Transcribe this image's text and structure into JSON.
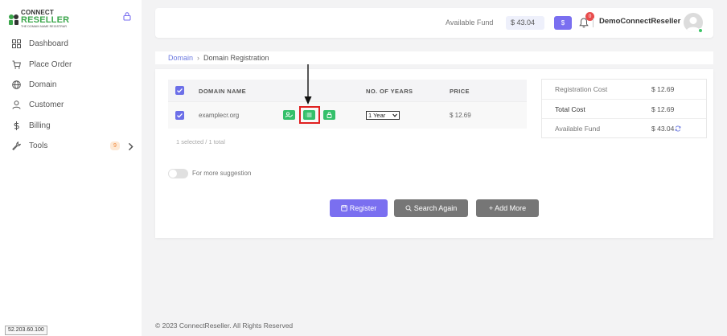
{
  "brand": {
    "line1": "CONNECT",
    "line2": "RESELLER",
    "tagline": "THE DOMAIN NAME REGISTRAR"
  },
  "sidebar": {
    "items": [
      {
        "label": "Dashboard",
        "icon": "grid-icon"
      },
      {
        "label": "Place Order",
        "icon": "cart-icon"
      },
      {
        "label": "Domain",
        "icon": "globe-icon"
      },
      {
        "label": "Customer",
        "icon": "user-icon"
      },
      {
        "label": "Billing",
        "icon": "dollar-icon"
      },
      {
        "label": "Tools",
        "icon": "wrench-icon",
        "badge": "9"
      }
    ]
  },
  "header": {
    "fund_label": "Available Fund",
    "fund_value": "$ 43.04",
    "add_fund_label": "$",
    "notifications_count": "0",
    "username": "DemoConnectReseller"
  },
  "breadcrumb": {
    "parent": "Domain",
    "separator": "›",
    "current": "Domain Registration"
  },
  "table": {
    "columns": {
      "domain": "DOMAIN NAME",
      "years": "NO. OF YEARS",
      "price": "PRICE"
    },
    "rows": [
      {
        "domain": "examplecr.org",
        "years": "1 Year",
        "price": "$ 12.69"
      }
    ],
    "selection_summary": "1 selected / 1 total"
  },
  "suggestion_toggle_label": "For more suggestion",
  "actions": {
    "register": "Register",
    "search_again": "Search Again",
    "add_more": "+ Add More"
  },
  "summary": {
    "registration_cost_label": "Registration Cost",
    "registration_cost": "$ 12.69",
    "total_cost_label": "Total Cost",
    "total_cost": "$ 12.69",
    "available_fund_label": "Available Fund",
    "available_fund": "$ 43.04"
  },
  "footer": "© 2023 ConnectReseller. All Rights Reserved",
  "ip_address": "52.203.60.100",
  "colors": {
    "accent": "#7a6ff0",
    "green": "#34c06a",
    "highlight": "#e02020"
  }
}
